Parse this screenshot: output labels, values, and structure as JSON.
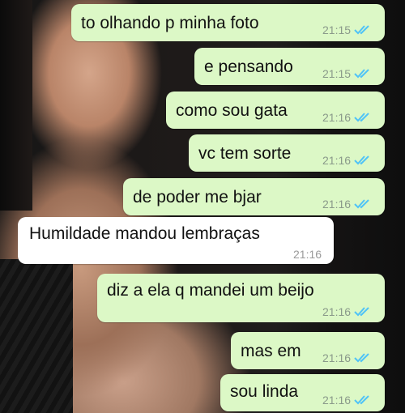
{
  "messages": [
    {
      "text": "to olhando p minha foto",
      "time": "21:15",
      "direction": "out",
      "read": true
    },
    {
      "text": "e pensando",
      "time": "21:15",
      "direction": "out",
      "read": true
    },
    {
      "text": "como sou gata",
      "time": "21:16",
      "direction": "out",
      "read": true
    },
    {
      "text": "vc tem sorte",
      "time": "21:16",
      "direction": "out",
      "read": true
    },
    {
      "text": "de poder me bjar",
      "time": "21:16",
      "direction": "out",
      "read": true
    },
    {
      "text": "Humildade mandou lembraças",
      "time": "21:16",
      "direction": "in",
      "read": false
    },
    {
      "text": "diz a ela q mandei um beijo",
      "time": "21:16",
      "direction": "out",
      "read": true
    },
    {
      "text": "mas em",
      "time": "21:16",
      "direction": "out",
      "read": true
    },
    {
      "text": "sou linda",
      "time": "21:16",
      "direction": "out",
      "read": true
    }
  ],
  "colors": {
    "outgoing_bubble": "#dcf8c6",
    "incoming_bubble": "#ffffff",
    "read_tick": "#4fc3f7"
  },
  "icons": {
    "read_receipt": "double-check-icon"
  }
}
